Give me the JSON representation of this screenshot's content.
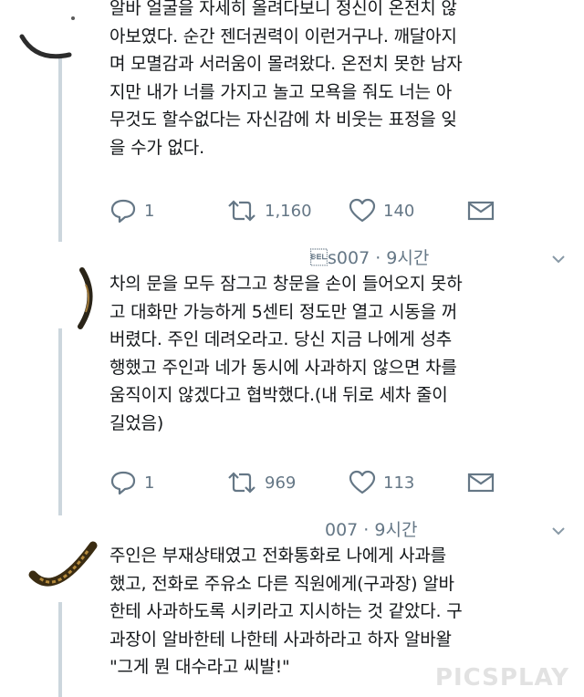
{
  "tweets": [
    {
      "text": "알바 얼굴을 자세히 올려다보니 정신이 온전치 않\n아보였다. 순간 젠더권력이 이런거구나. 깨달아지\n며 모멸감과 서러움이 몰려왔다. 온전치 못한 남자\n지만 내가 너를 가지고 놀고 모욕을 줘도 너는 아\n무것도 할수없다는 자신감에 차 비웃는 표정을 잊\n을 수가 없다.",
      "reply_count": "1",
      "retweet_count": "1,160",
      "like_count": "140"
    },
    {
      "header": "\u0007s007 · 9시간",
      "text": "차의 문을 모두 잠그고 창문을 손이 들어오지 못하\n고 대화만 가능하게 5센티 정도만 열고 시동을 꺼\n버렸다. 주인 데려오라고. 당신 지금 나에게 성추\n행했고 주인과 네가 동시에 사과하지 않으면 차를\n움직이지 않겠다고 협박했다.(내 뒤로 세차 줄이\n길었음)",
      "reply_count": "1",
      "retweet_count": "969",
      "like_count": "113"
    },
    {
      "header": "007 · 9시간",
      "text": "주인은 부재상태였고 전화통화로 나에게 사과를\n했고, 전화로 주유소 다른 직원에게(구과장) 알바\n한테 사과하도록 시키라고 지시하는 것 같았다. 구\n과장이 알바한테 나한테 사과하라고 하자 알바왈\n\"그게 뭔 대수라고 씨발!\""
    }
  ],
  "watermark": "PICSPLAY",
  "icons": {
    "reply": "reply-icon",
    "retweet": "retweet-icon",
    "like": "heart-icon",
    "dm": "envelope-icon",
    "caret": "chevron-down-icon"
  },
  "colors": {
    "text": "#14171a",
    "muted": "#657786",
    "thread_line": "#ccd6dd"
  }
}
